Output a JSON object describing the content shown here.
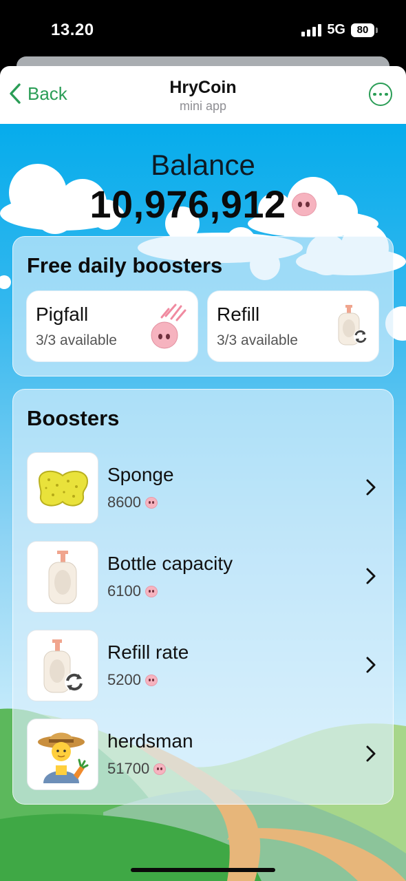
{
  "status_bar": {
    "time": "13.20",
    "network": "5G",
    "battery": "80"
  },
  "header": {
    "back_label": "Back",
    "title": "HryCoin",
    "subtitle": "mini app"
  },
  "balance": {
    "label": "Balance",
    "value": "10,976,912"
  },
  "free_boosters": {
    "title": "Free daily boosters",
    "items": [
      {
        "name": "Pigfall",
        "availability": "3/3 available",
        "icon": "falling-pig-icon"
      },
      {
        "name": "Refill",
        "availability": "3/3 available",
        "icon": "bottle-refill-icon"
      }
    ]
  },
  "boosters": {
    "title": "Boosters",
    "items": [
      {
        "name": "Sponge",
        "price": "8600",
        "icon": "sponge-icon"
      },
      {
        "name": "Bottle capacity",
        "price": "6100",
        "icon": "lotion-bottle-icon"
      },
      {
        "name": "Refill rate",
        "price": "5200",
        "icon": "bottle-refill-icon"
      },
      {
        "name": "herdsman",
        "price": "51700",
        "icon": "farmer-icon"
      }
    ]
  },
  "colors": {
    "accent": "#2a9d56",
    "sky_top": "#06acec",
    "grass": "#4caf50",
    "pig_pink": "#f6b3bf"
  }
}
